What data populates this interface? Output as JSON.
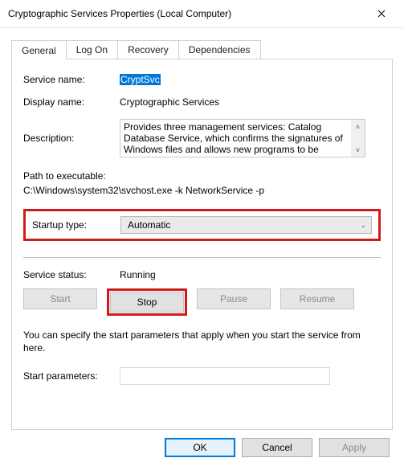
{
  "window": {
    "title": "Cryptographic Services Properties (Local Computer)"
  },
  "tabs": [
    "General",
    "Log On",
    "Recovery",
    "Dependencies"
  ],
  "general": {
    "serviceNameLabel": "Service name:",
    "serviceName": "CryptSvc",
    "displayNameLabel": "Display name:",
    "displayName": "Cryptographic Services",
    "descriptionLabel": "Description:",
    "description": "Provides three management services: Catalog Database Service, which confirms the signatures of Windows files and allows new programs to be",
    "pathLabel": "Path to executable:",
    "path": "C:\\Windows\\system32\\svchost.exe -k NetworkService -p",
    "startupTypeLabel": "Startup type:",
    "startupType": "Automatic",
    "statusLabel": "Service status:",
    "status": "Running",
    "buttons": {
      "start": "Start",
      "stop": "Stop",
      "pause": "Pause",
      "resume": "Resume"
    },
    "paramsHint": "You can specify the start parameters that apply when you start the service from here.",
    "startParamsLabel": "Start parameters:"
  },
  "footer": {
    "ok": "OK",
    "cancel": "Cancel",
    "apply": "Apply"
  }
}
